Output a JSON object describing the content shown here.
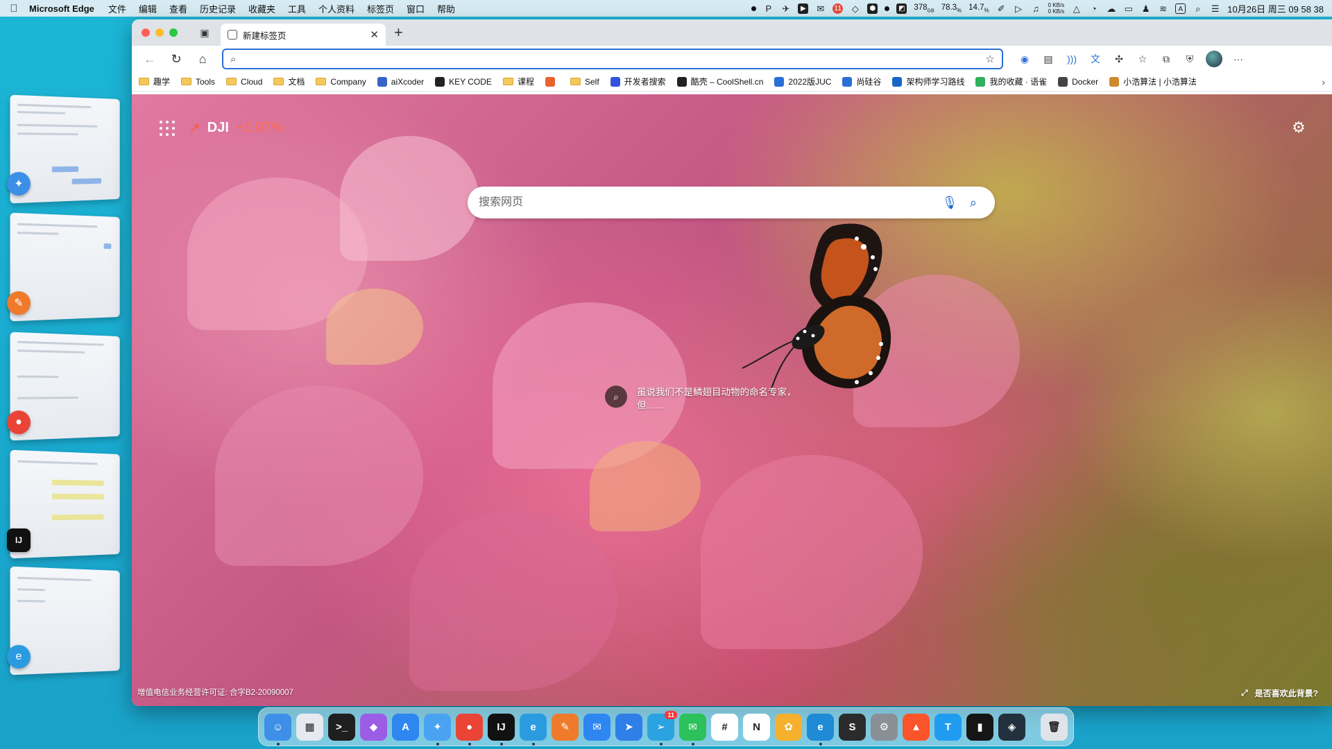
{
  "menubar": {
    "app_name": "Microsoft Edge",
    "items": [
      "文件",
      "编辑",
      "查看",
      "历史记录",
      "收藏夹",
      "工具",
      "个人资料",
      "标签页",
      "窗口",
      "帮助"
    ],
    "status": {
      "mem": "378",
      "mem_unit": "GB",
      "cpu": "78.3",
      "cpu_unit": "%",
      "battery": "14.7",
      "battery_unit": "%",
      "net_up": "0 KB/s",
      "net_down": "0 KB/s",
      "notification_badge": "11",
      "clock": "10月26日 周三 09 58 38"
    }
  },
  "browser": {
    "tab": {
      "title": "新建标签页"
    },
    "address": {
      "value": "",
      "placeholder": ""
    },
    "bookmarks": [
      {
        "label": "趣学",
        "type": "folder"
      },
      {
        "label": "Tools",
        "type": "folder"
      },
      {
        "label": "Cloud",
        "type": "folder"
      },
      {
        "label": "文档",
        "type": "folder"
      },
      {
        "label": "Company",
        "type": "folder"
      },
      {
        "label": "aiXcoder",
        "type": "site",
        "color": "#3a63c8"
      },
      {
        "label": "KEY CODE",
        "type": "site",
        "color": "#222222"
      },
      {
        "label": "课程",
        "type": "folder"
      },
      {
        "label": "",
        "type": "site",
        "color": "#e8632d"
      },
      {
        "label": "Self",
        "type": "folder"
      },
      {
        "label": "开发者搜索",
        "type": "site",
        "color": "#3355dd"
      },
      {
        "label": "酷壳 – CoolShell.cn",
        "type": "site",
        "color": "#222222"
      },
      {
        "label": "2022版JUC",
        "type": "site",
        "color": "#2a6fd6"
      },
      {
        "label": "尚硅谷",
        "type": "site",
        "color": "#2a6fd6"
      },
      {
        "label": "架构师学习路线",
        "type": "site",
        "color": "#1a66c8"
      },
      {
        "label": "我的收藏 · 语雀",
        "type": "site",
        "color": "#30b060"
      },
      {
        "label": "Docker",
        "type": "site",
        "color": "#444444"
      },
      {
        "label": "小浩算法 | 小浩算法",
        "type": "site",
        "color": "#d08830"
      }
    ]
  },
  "ntp": {
    "ticker": {
      "symbol": "DJI",
      "change": "+1.07%"
    },
    "search": {
      "placeholder": "搜索网页"
    },
    "caption": {
      "line1": "虽说我们不是鳞翅目动物的命名专家，",
      "line2": "但……"
    },
    "license": "增值电信业务经营许可证: 合字B2-20090007",
    "like_bg": "是否喜欢此背景?"
  },
  "dock": {
    "apps": [
      {
        "name": "finder",
        "glyph": "☺",
        "color": "#3d8fe8",
        "running": true
      },
      {
        "name": "launchpad",
        "glyph": "▦",
        "color": "#e6e9ef",
        "running": false
      },
      {
        "name": "terminal",
        "glyph": ">_",
        "color": "#1f1f1f",
        "running": false
      },
      {
        "name": "shortcuts",
        "glyph": "◆",
        "color": "#9b5de5",
        "running": false
      },
      {
        "name": "app-store",
        "glyph": "A",
        "color": "#2e86f0",
        "running": false
      },
      {
        "name": "safari",
        "glyph": "✦",
        "color": "#4aa3f0",
        "running": true
      },
      {
        "name": "chrome",
        "glyph": "●",
        "color": "#e94435",
        "running": true
      },
      {
        "name": "intellij",
        "glyph": "IJ",
        "color": "#111111",
        "running": true
      },
      {
        "name": "edge",
        "glyph": "e",
        "color": "#2b9be0",
        "running": true
      },
      {
        "name": "pencil",
        "glyph": "✎",
        "color": "#f07a2b",
        "running": false
      },
      {
        "name": "airmail",
        "glyph": "✉",
        "color": "#2e86f0",
        "running": false
      },
      {
        "name": "migrate",
        "glyph": "➤",
        "color": "#2e7fe8",
        "running": false
      },
      {
        "name": "telegram",
        "glyph": "➢",
        "color": "#2aa3e0",
        "running": true,
        "badge": "11"
      },
      {
        "name": "wechat",
        "glyph": "✉",
        "color": "#2cc15a",
        "running": true
      },
      {
        "name": "slack",
        "glyph": "#",
        "color": "#ffffff",
        "running": false
      },
      {
        "name": "notion",
        "glyph": "N",
        "color": "#ffffff",
        "running": false
      },
      {
        "name": "craft",
        "glyph": "✿",
        "color": "#f5b02e",
        "running": false
      },
      {
        "name": "edge-canary",
        "glyph": "e",
        "color": "#1f8ad6",
        "running": true
      },
      {
        "name": "sublime",
        "glyph": "S",
        "color": "#2b2b2b",
        "running": false
      },
      {
        "name": "settings",
        "glyph": "⚙",
        "color": "#8a8f96",
        "running": false
      },
      {
        "name": "brave",
        "glyph": "▲",
        "color": "#fb542b",
        "running": false
      },
      {
        "name": "tower",
        "glyph": "T",
        "color": "#1f9cf0",
        "running": false
      },
      {
        "name": "istat",
        "glyph": "▮",
        "color": "#151515",
        "running": false
      },
      {
        "name": "dev-tool",
        "glyph": "◈",
        "color": "#23303d",
        "running": false
      },
      {
        "name": "trash",
        "glyph": "🗑",
        "color": "#dfe4ea",
        "running": false
      }
    ]
  }
}
